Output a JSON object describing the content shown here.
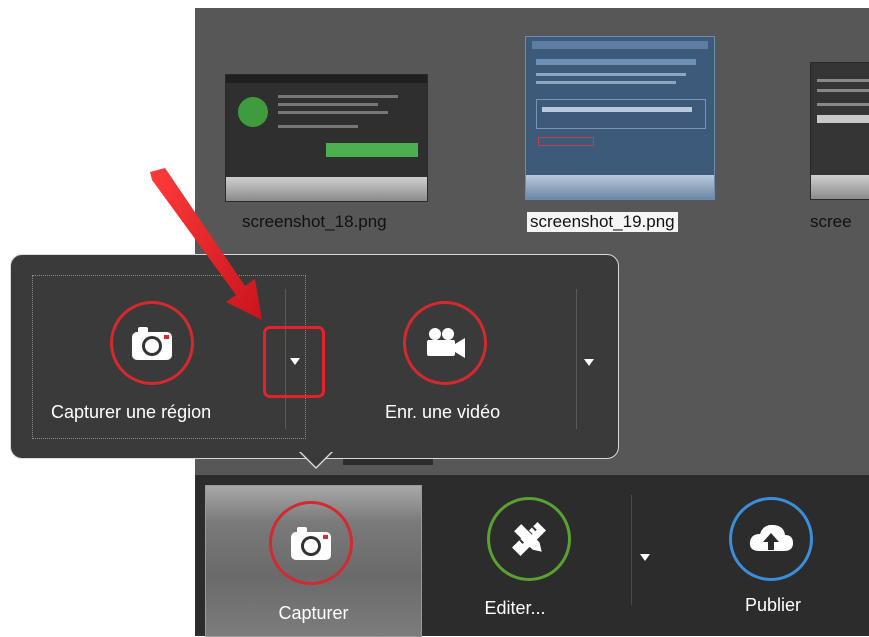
{
  "thumbnails": [
    {
      "file_name": "screenshot_18.png",
      "selected": false
    },
    {
      "file_name": "screenshot_19.png",
      "selected": true
    },
    {
      "file_name": "scree",
      "selected": false
    }
  ],
  "popup": {
    "region_label": "Capturer une région",
    "video_label": "Enr. une vidéo"
  },
  "taskbar": {
    "capture_label": "Capturer",
    "edit_label": "Editer...",
    "publish_label": "Publier"
  },
  "colors": {
    "capture_accent": "#d3292f",
    "edit_accent": "#5aa130",
    "publish_accent": "#3b8ed9",
    "annotation_red": "#e5212a"
  },
  "icons": {
    "region": "camera-icon",
    "video": "video-camera-icon",
    "capture": "camera-icon",
    "edit": "pencil-ruler-icon",
    "publish": "cloud-upload-icon"
  }
}
